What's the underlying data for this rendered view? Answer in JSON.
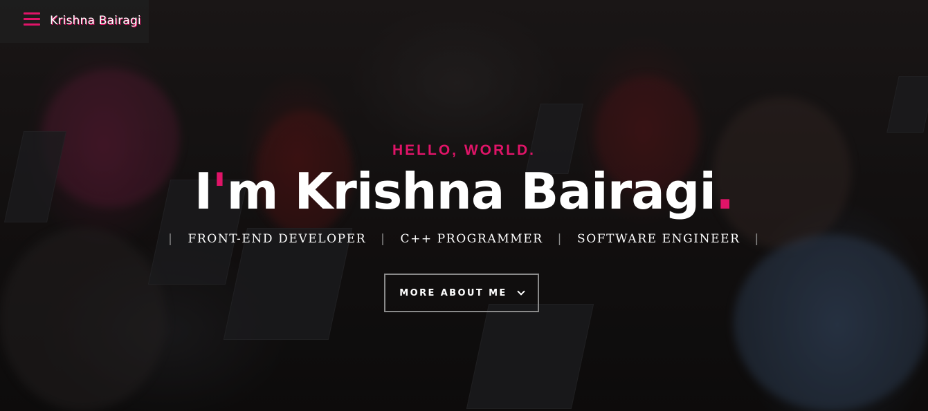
{
  "header": {
    "menu_icon": "hamburger-menu-icon",
    "brand": "Krishna Bairagi"
  },
  "hero": {
    "kicker": "HELLO, WORLD.",
    "title_prefix": "I",
    "title_quote": "'",
    "title_main": "m Krishna Bairagi",
    "title_dot": ".",
    "roles": [
      "FRONT-END DEVELOPER",
      "C++ PROGRAMMER",
      "SOFTWARE ENGINEER"
    ],
    "separator": "|",
    "more_button": "MORE ABOUT ME",
    "more_button_icon": "chevron-down-icon"
  },
  "colors": {
    "accent": "#e01468",
    "text": "#ffffff",
    "header_bg": "#1e1e1e"
  }
}
